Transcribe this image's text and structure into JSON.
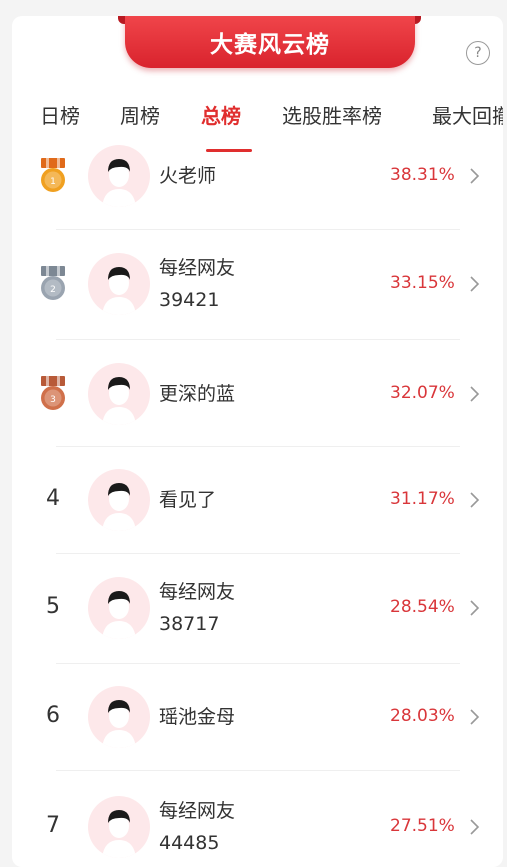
{
  "banner": {
    "title": "大赛风云榜"
  },
  "help": {
    "label": "?"
  },
  "tabs": [
    {
      "label": "日榜"
    },
    {
      "label": "周榜"
    },
    {
      "label": "总榜"
    },
    {
      "label": "选股胜率榜"
    },
    {
      "label": "最大回撤"
    }
  ],
  "rankings": [
    {
      "rank": "1",
      "name_line1": "火老师",
      "name_line2": "",
      "rate": "38.31%",
      "medal": "gold"
    },
    {
      "rank": "2",
      "name_line1": "每经网友",
      "name_line2": "39421",
      "rate": "33.15%",
      "medal": "silver"
    },
    {
      "rank": "3",
      "name_line1": "更深的蓝",
      "name_line2": "",
      "rate": "32.07%",
      "medal": "bronze"
    },
    {
      "rank": "4",
      "name_line1": "看见了",
      "name_line2": "",
      "rate": "31.17%"
    },
    {
      "rank": "5",
      "name_line1": "每经网友",
      "name_line2": "38717",
      "rate": "28.54%"
    },
    {
      "rank": "6",
      "name_line1": "瑶池金母",
      "name_line2": "",
      "rate": "28.03%"
    },
    {
      "rank": "7",
      "name_line1": "每经网友",
      "name_line2": "44485",
      "rate": "27.51%"
    }
  ],
  "colors": {
    "accent": "#e02e2e",
    "rate": "#d9363a",
    "gold": "#f0a020",
    "silver": "#9aa4b0",
    "bronze": "#d0704a"
  }
}
